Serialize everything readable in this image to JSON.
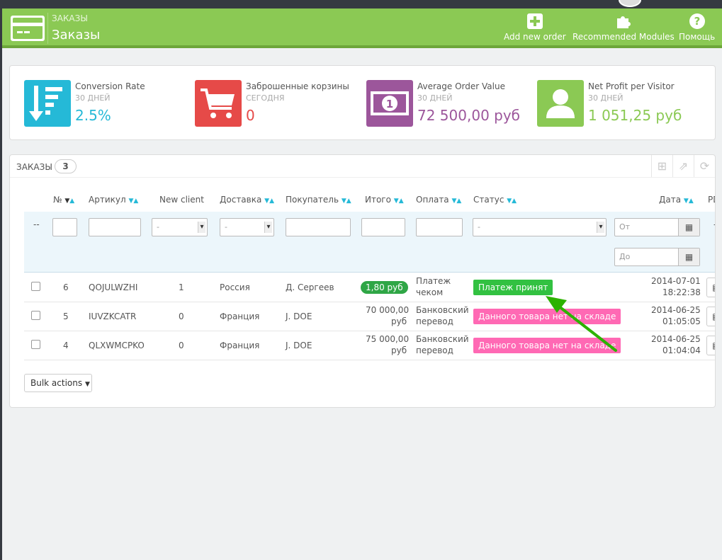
{
  "header": {
    "breadcrumb": "ЗАКАЗЫ",
    "title": "Заказы",
    "toolbar": [
      {
        "label": "Add new order",
        "icon": "plus-square-icon"
      },
      {
        "label": "Recommended Modules",
        "icon": "puzzle-icon"
      },
      {
        "label": "Помощь",
        "icon": "help-icon"
      }
    ]
  },
  "kpis": [
    {
      "label": "Conversion Rate",
      "period": "30 ДНЕЙ",
      "value": "2.5%",
      "color": "#25b9d7",
      "icon": "sort-amount-down-icon"
    },
    {
      "label": "Заброшенные корзины",
      "period": "СЕГОДНЯ",
      "value": "0",
      "color": "#e64a48",
      "icon": "shopping-cart-icon"
    },
    {
      "label": "Average Order Value",
      "period": "30 ДНЕЙ",
      "value": "72 500,00 руб",
      "color": "#9c569b",
      "icon": "money-icon"
    },
    {
      "label": "Net Profit per Visitor",
      "period": "30 ДНЕЙ",
      "value": "1 051,25 руб",
      "color": "#8bc954",
      "icon": "user-icon"
    }
  ],
  "orders_panel": {
    "title": "ЗАКАЗЫ",
    "count": "3",
    "columns": [
      "№",
      "Артикул",
      "New client",
      "Доставка",
      "Покупатель",
      "Итого",
      "Оплата",
      "Статус",
      "Дата",
      "PDF"
    ],
    "filters": {
      "id_placeholder": "--",
      "select_default": "-",
      "date_from": "От",
      "date_to": "До",
      "pdf_placeholder": "--"
    },
    "rows": [
      {
        "id": "6",
        "reference": "QOJULWZHI",
        "new_client": "1",
        "country": "Россия",
        "customer": "Д. Сергеев",
        "total": "1,80 руб",
        "total_badge": true,
        "payment_line1": "Платеж",
        "payment_line2": "чеком",
        "status": "Платеж принят",
        "status_color": "#32c141",
        "date": "2014-07-01",
        "time": "18:22:38"
      },
      {
        "id": "5",
        "reference": "IUVZKCATR",
        "new_client": "0",
        "country": "Франция",
        "customer": "J. DOE",
        "total_line1": "70 000,00",
        "total_line2": "руб",
        "total_badge": false,
        "payment_line1": "Банковский",
        "payment_line2": "перевод",
        "status": "Данного товара нет на складе",
        "status_color": "#ff69b4",
        "date": "2014-06-25",
        "time": "01:05:05"
      },
      {
        "id": "4",
        "reference": "QLXWMCPKO",
        "new_client": "0",
        "country": "Франция",
        "customer": "J. DOE",
        "total_line1": "75 000,00",
        "total_line2": "руб",
        "total_badge": false,
        "payment_line1": "Банковский",
        "payment_line2": "перевод",
        "status": "Данного товара нет на складе",
        "status_color": "#ff69b4",
        "date": "2014-06-25",
        "time": "01:04:04"
      }
    ],
    "bulk_actions_label": "Bulk actions"
  }
}
